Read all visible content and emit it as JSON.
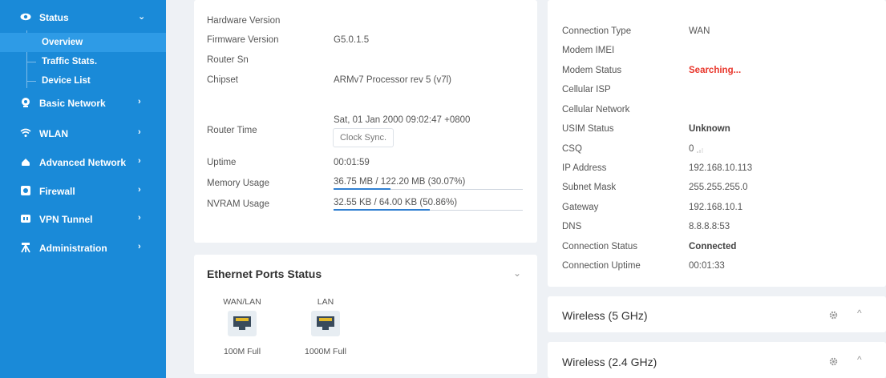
{
  "sidebar": {
    "items": [
      {
        "label": "Status",
        "icon": "eye-icon",
        "arrow": "⌄"
      },
      {
        "label": "Basic Network",
        "icon": "globe-icon",
        "arrow": "›"
      },
      {
        "label": "WLAN",
        "icon": "wifi-icon",
        "arrow": "›"
      },
      {
        "label": "Advanced Network",
        "icon": "cloud-icon",
        "arrow": "›"
      },
      {
        "label": "Firewall",
        "icon": "shield-icon",
        "arrow": "›"
      },
      {
        "label": "VPN Tunnel",
        "icon": "vpn-icon",
        "arrow": "›"
      },
      {
        "label": "Administration",
        "icon": "admin-icon",
        "arrow": "›"
      }
    ],
    "sub_items": [
      "Overview",
      "Traffic Stats.",
      "Device List"
    ],
    "active_sub": "Overview"
  },
  "system": {
    "hardware_version_label": "Hardware Version",
    "firmware_version_label": "Firmware Version",
    "firmware_version": "G5.0.1.5",
    "router_sn_label": "Router Sn",
    "chipset_label": "Chipset",
    "chipset": "ARMv7 Processor rev 5 (v7l)",
    "router_time_label": "Router Time",
    "router_time": "Sat, 01 Jan 2000 09:02:47 +0800",
    "clock_sync_label": "Clock Sync.",
    "uptime_label": "Uptime",
    "uptime": "00:01:59",
    "memory_label": "Memory Usage",
    "memory": "36.75 MB / 122.20 MB (30.07%)",
    "memory_fraction": 0.3007,
    "nvram_label": "NVRAM Usage",
    "nvram": "32.55 KB / 64.00 KB (50.86%)",
    "nvram_fraction": 0.5086
  },
  "ethernet": {
    "title": "Ethernet Ports Status",
    "ports": [
      {
        "name": "WAN/LAN",
        "speed": "100M Full"
      },
      {
        "name": "LAN",
        "speed": "1000M Full"
      }
    ]
  },
  "modem": {
    "connection_type_label": "Connection Type",
    "connection_type": "WAN",
    "modem_imei_label": "Modem IMEI",
    "modem_status_label": "Modem Status",
    "modem_status": "Searching...",
    "cellular_isp_label": "Cellular ISP",
    "cellular_network_label": "Cellular Network",
    "usim_status_label": "USIM Status",
    "usim_status": "Unknown",
    "csq_label": "CSQ",
    "csq": "0",
    "ip_address_label": "IP Address",
    "ip_address": "192.168.10.113",
    "subnet_mask_label": "Subnet Mask",
    "subnet_mask": "255.255.255.0",
    "gateway_label": "Gateway",
    "gateway": "192.168.10.1",
    "dns_label": "DNS",
    "dns": "8.8.8.8:53",
    "connection_status_label": "Connection Status",
    "connection_status": "Connected",
    "connection_uptime_label": "Connection Uptime",
    "connection_uptime": "00:01:33"
  },
  "wireless_5": {
    "title": "Wireless (5 GHz)"
  },
  "wireless_24": {
    "title": "Wireless (2.4 GHz)"
  },
  "colors": {
    "sidebar": "#1a8ad8",
    "accent": "#2f7fd1",
    "alert": "#e8352a"
  }
}
